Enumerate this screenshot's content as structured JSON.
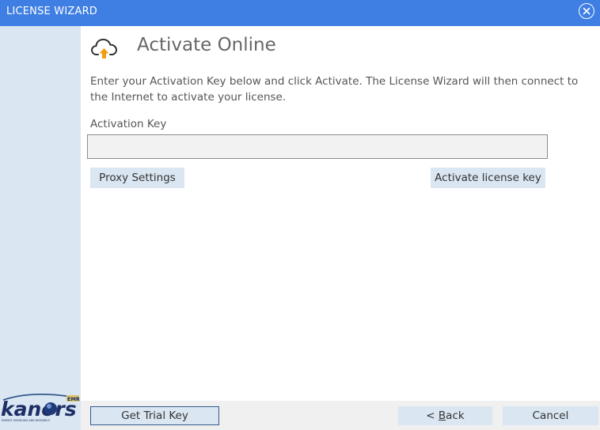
{
  "window": {
    "title": "LICENSE WIZARD",
    "close_icon": "close-circle-icon",
    "titlebar_color": "#3f7fe3",
    "sidebar_color": "#dae6f2"
  },
  "header": {
    "icon": "cloud-upload-icon",
    "title": "Activate Online",
    "accent_color": "#f39c12"
  },
  "main": {
    "intro": "Enter your Activation Key below and click Activate. The License Wizard will then connect to the Internet to activate your license.",
    "activation_key_label": "Activation Key",
    "activation_key_value": "",
    "proxy_button": "Proxy Settings",
    "activate_button": "Activate license key"
  },
  "footer": {
    "trial_button": "Get Trial Key",
    "back_prefix": "< ",
    "back_mnemonic": "B",
    "back_rest": "ack",
    "cancel_button": "Cancel"
  },
  "logo": {
    "text": "kanors",
    "badge": "EMR",
    "tagline": "ENERGY MODELING AND RESEARCH"
  }
}
